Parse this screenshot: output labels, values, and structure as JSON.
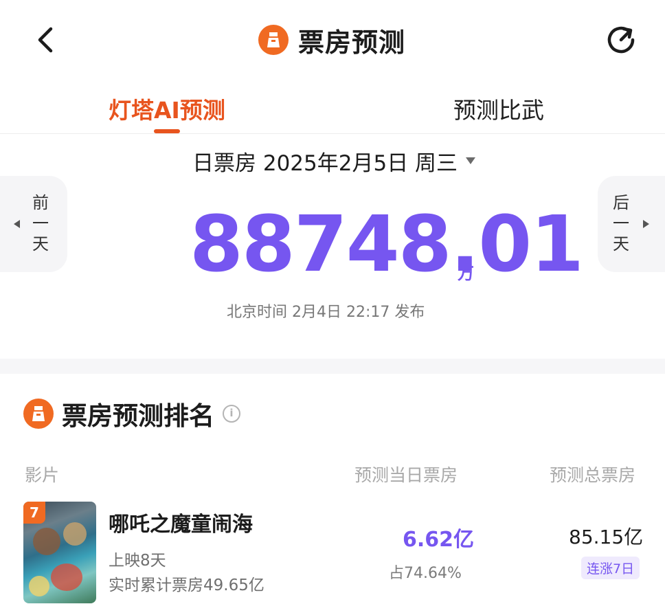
{
  "header": {
    "title": "票房预测"
  },
  "tabs": [
    {
      "label": "灯塔AI预测",
      "active": true
    },
    {
      "label": "预测比武",
      "active": false
    }
  ],
  "date_selector": {
    "label": "日票房 2025年2月5日 周三"
  },
  "nav": {
    "prev_lines": [
      "前",
      "一",
      "天"
    ],
    "next_lines": [
      "后",
      "一",
      "天"
    ]
  },
  "forecast": {
    "value": "88748.01",
    "unit": "万",
    "published": "北京时间 2月4日 22:17 发布"
  },
  "ranking": {
    "title": "票房预测排名",
    "info_icon_glyph": "i",
    "columns": [
      "影片",
      "预测当日票房",
      "预测总票房"
    ],
    "rows": [
      {
        "rank": "7",
        "name": "哪吒之魔童闹海",
        "days_showing": "上映8天",
        "cumulative": "实时累计票房49.65亿",
        "day_box_office": "6.62亿",
        "day_share": "占74.64%",
        "total_box_office": "85.15亿",
        "streak": "连涨7日"
      }
    ]
  },
  "colors": {
    "accent_orange": "#e8541e",
    "accent_purple": "#7656f0"
  },
  "icons": [
    "back-arrow-icon",
    "lighthouse-logo-icon",
    "refresh-icon",
    "caret-down-icon",
    "info-icon"
  ]
}
